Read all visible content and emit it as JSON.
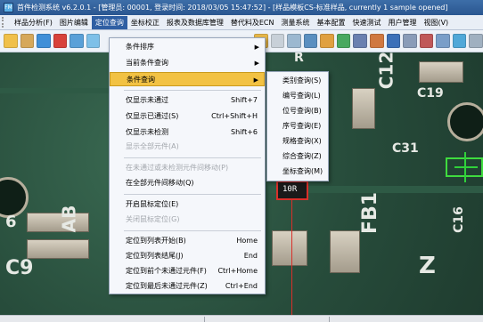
{
  "window": {
    "app_icon_text": "FM",
    "title": "首件检测系统 v6.2.0.1 - [管理员: 00001, 登录时间: 2018/03/05 15:47:52] - [样品模板CS-标准样品, currently 1 sample opened]"
  },
  "menubar": {
    "items": [
      {
        "label": "样品分析(F)"
      },
      {
        "label": "图片编辑"
      },
      {
        "label": "定位查询"
      },
      {
        "label": "坐标校正"
      },
      {
        "label": "报表及数据库管理"
      },
      {
        "label": "替代料及ECN"
      },
      {
        "label": "测量系统"
      },
      {
        "label": "基本配置"
      },
      {
        "label": "快速测试"
      },
      {
        "label": "用户管理"
      },
      {
        "label": "视图(V)"
      }
    ]
  },
  "toolbar": {
    "icons": [
      "open-icon",
      "edit-icon",
      "save-icon",
      "image-icon",
      "zoom-icon",
      "zoom-icon",
      "rotate-icon",
      "grid-icon",
      "search-icon",
      "layers-icon",
      "flag-icon",
      "chart-icon",
      "filter-icon",
      "settings-icon",
      "camera-icon"
    ]
  },
  "canvas": {
    "labels": {
      "c12": "C12",
      "c19": "C19",
      "c31": "C31",
      "c16": "C16",
      "r_top": "R",
      "ab": "AB",
      "c9": "C9",
      "fb1": "FB1",
      "z": "Z",
      "six": "6",
      "hl": "10R"
    }
  },
  "dropdown": {
    "items": [
      {
        "label": "条件排序",
        "shortcut": "",
        "arrow": "▶",
        "disabled": false
      },
      {
        "label": "当前条件查询",
        "shortcut": "",
        "arrow": "▶",
        "disabled": false
      },
      {
        "label": "条件查询",
        "shortcut": "",
        "arrow": "▶",
        "disabled": false
      },
      {
        "label": "仅显示未通过",
        "shortcut": "Shift+7",
        "arrow": "",
        "disabled": false
      },
      {
        "label": "仅显示已通过(S)",
        "shortcut": "Ctrl+Shift+H",
        "arrow": "",
        "disabled": false
      },
      {
        "label": "仅显示未检测",
        "shortcut": "Shift+6",
        "arrow": "",
        "disabled": false
      },
      {
        "label": "显示全部元件(A)",
        "shortcut": "",
        "arrow": "",
        "disabled": true
      },
      {
        "label": "在未通过或未检测元件间移动(P)",
        "shortcut": "",
        "arrow": "",
        "disabled": true
      },
      {
        "label": "在全部元件间移动(Q)",
        "shortcut": "",
        "arrow": "",
        "disabled": false
      },
      {
        "label": "开启鼠标定位(E)",
        "shortcut": "",
        "arrow": "",
        "disabled": false
      },
      {
        "label": "关闭鼠标定位(G)",
        "shortcut": "",
        "arrow": "",
        "disabled": true
      },
      {
        "label": "定位到列表开始(B)",
        "shortcut": "Home",
        "arrow": "",
        "disabled": false
      },
      {
        "label": "定位到列表结尾(J)",
        "shortcut": "End",
        "arrow": "",
        "disabled": false
      },
      {
        "label": "定位到前个未通过元件(F)",
        "shortcut": "Ctrl+Home",
        "arrow": "",
        "disabled": false
      },
      {
        "label": "定位到最后未通过元件(Z)",
        "shortcut": "Ctrl+End",
        "arrow": "",
        "disabled": false
      }
    ]
  },
  "submenu": {
    "items": [
      {
        "label": "类别查询(S)"
      },
      {
        "label": "编号查询(L)"
      },
      {
        "label": "位号查询(B)"
      },
      {
        "label": "序号查询(E)"
      },
      {
        "label": "规格查询(X)"
      },
      {
        "label": "综合查询(Z)"
      },
      {
        "label": "坐标查询(M)"
      }
    ]
  },
  "colors": {
    "titlebar": "#2a5690",
    "menu_active": "#2f5fa3",
    "menu_hover": "#f2c243",
    "pcb_green": "#274c3b",
    "highlight_red": "#d9302a",
    "crosshair_green": "#2fd13a"
  }
}
